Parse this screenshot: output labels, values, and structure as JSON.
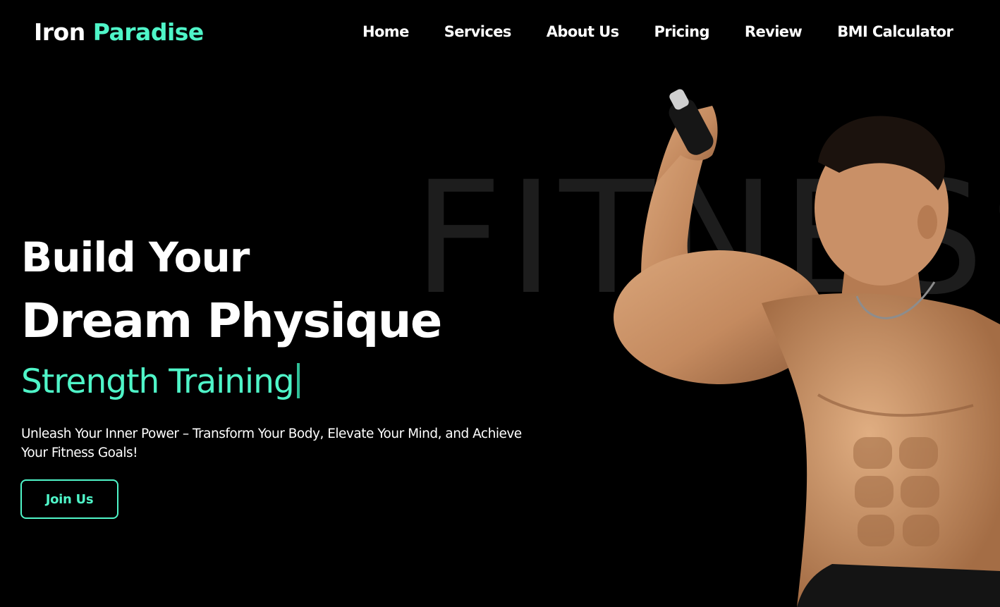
{
  "brand": {
    "name_part1": "Iron",
    "name_part2": "Paradise",
    "accent_color": "#4ff5c8"
  },
  "nav": {
    "items": [
      {
        "label": "Home"
      },
      {
        "label": "Services"
      },
      {
        "label": "About Us"
      },
      {
        "label": "Pricing"
      },
      {
        "label": "Review"
      },
      {
        "label": "BMI Calculator"
      }
    ]
  },
  "hero": {
    "watermark": "FITNESS",
    "headline_line1": "Build Your",
    "headline_line2": "Dream Physique",
    "typed_text": "Strength Training",
    "description": "Unleash Your Inner Power – Transform Your Body, Elevate Your Mind, and Achieve Your Fitness Goals!",
    "cta_label": "Join Us",
    "image_icon": "shirtless-athlete-with-dumbbell-image"
  },
  "colors": {
    "background": "#000000",
    "accent": "#4ff5c8",
    "text": "#ffffff"
  }
}
